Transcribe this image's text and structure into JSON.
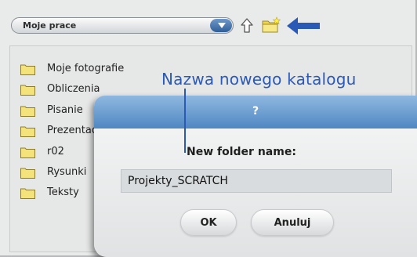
{
  "browser": {
    "directory": "Moje prace",
    "up_icon": "up-arrow-icon",
    "new_folder_icon": "new-folder-icon",
    "folders": [
      {
        "name": "Moje fotografie"
      },
      {
        "name": "Obliczenia"
      },
      {
        "name": "Pisanie"
      },
      {
        "name": "Prezentacje"
      },
      {
        "name": "r02"
      },
      {
        "name": "Rysunki"
      },
      {
        "name": "Teksty"
      }
    ]
  },
  "annotation": {
    "text": "Nazwa nowego katalogu",
    "color": "#2b59b6"
  },
  "dialog": {
    "title": "?",
    "field_label": "New folder name:",
    "input_value": "Projekty_SCRATCH",
    "ok_label": "OK",
    "cancel_label": "Anuluj"
  },
  "colors": {
    "accent": "#4f87c2",
    "annotation": "#2b59b6",
    "folder": "#f4e27a"
  }
}
